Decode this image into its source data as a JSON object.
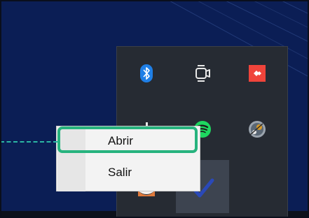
{
  "context_menu": {
    "items": [
      {
        "label": "Abrir",
        "highlighted": true
      },
      {
        "label": "Salir",
        "highlighted": false
      }
    ],
    "highlight_color": "#27b37e"
  },
  "tray": {
    "icons": [
      "bluetooth-icon",
      "camera-icon",
      "anydesk-icon",
      "usb-icon",
      "spotify-icon",
      "steam-icon",
      "app-icon",
      "checkmark-icon"
    ]
  },
  "colors": {
    "desktop": "#0b1e55",
    "tray_background": "#262b33",
    "menu_background": "#f3f3f3"
  }
}
